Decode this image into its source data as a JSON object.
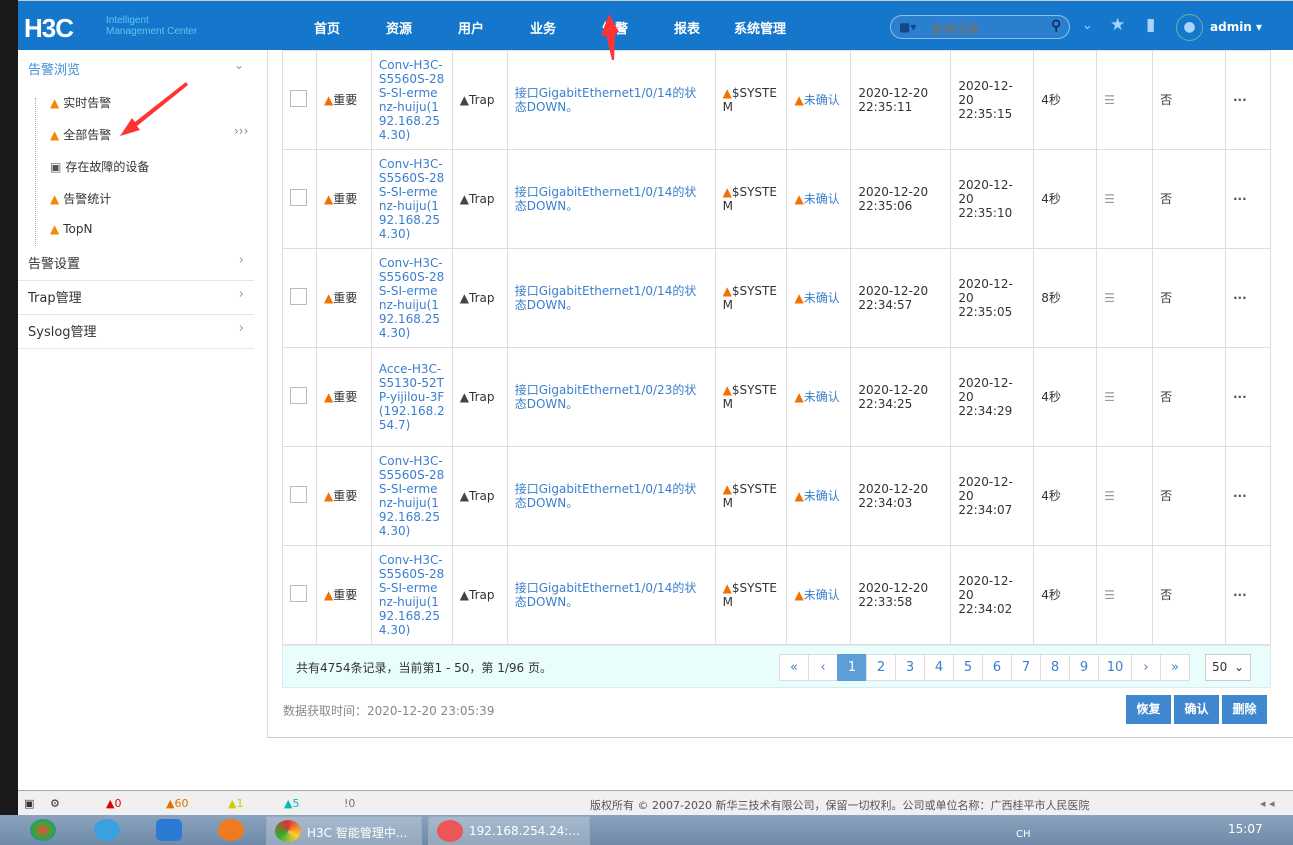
{
  "header": {
    "logo": "H3C",
    "logo_sub1": "Intelligent",
    "logo_sub2": "Management Center",
    "nav": [
      "首页",
      "资源",
      "用户",
      "业务",
      "告警",
      "报表",
      "系统管理"
    ],
    "search_placeholder": "查询设备",
    "user": "admin"
  },
  "sidebar": {
    "top": "告警浏览",
    "items": [
      "实时告警",
      "全部告警",
      "存在故障的设备",
      "告警统计",
      "TopN"
    ],
    "sections": [
      "告警设置",
      "Trap管理",
      "Syslog管理"
    ]
  },
  "rows": [
    {
      "level": "重要",
      "device": "Conv-H3C-S5560S-28S-SI-ermenz-huiju(192.168.254.30)",
      "type": "Trap",
      "desc": "接口GigabitEthernet1/0/14的状态DOWN。",
      "source": "$SYSTEM",
      "status": "未确认",
      "t1": "2020-12-20 22:35:11",
      "t2": "2020-12-20 22:35:15",
      "dur": "4秒",
      "flag": "否"
    },
    {
      "level": "重要",
      "device": "Conv-H3C-S5560S-28S-SI-ermenz-huiju(192.168.254.30)",
      "type": "Trap",
      "desc": "接口GigabitEthernet1/0/14的状态DOWN。",
      "source": "$SYSTEM",
      "status": "未确认",
      "t1": "2020-12-20 22:35:06",
      "t2": "2020-12-20 22:35:10",
      "dur": "4秒",
      "flag": "否"
    },
    {
      "level": "重要",
      "device": "Conv-H3C-S5560S-28S-SI-ermenz-huiju(192.168.254.30)",
      "type": "Trap",
      "desc": "接口GigabitEthernet1/0/14的状态DOWN。",
      "source": "$SYSTEM",
      "status": "未确认",
      "t1": "2020-12-20 22:34:57",
      "t2": "2020-12-20 22:35:05",
      "dur": "8秒",
      "flag": "否"
    },
    {
      "level": "重要",
      "device": "Acce-H3C-S5130-52TP-yijilou-3F(192.168.254.7)",
      "type": "Trap",
      "desc": "接口GigabitEthernet1/0/23的状态DOWN。",
      "source": "$SYSTEM",
      "status": "未确认",
      "t1": "2020-12-20 22:34:25",
      "t2": "2020-12-20 22:34:29",
      "dur": "4秒",
      "flag": "否"
    },
    {
      "level": "重要",
      "device": "Conv-H3C-S5560S-28S-SI-ermenz-huiju(192.168.254.30)",
      "type": "Trap",
      "desc": "接口GigabitEthernet1/0/14的状态DOWN。",
      "source": "$SYSTEM",
      "status": "未确认",
      "t1": "2020-12-20 22:34:03",
      "t2": "2020-12-20 22:34:07",
      "dur": "4秒",
      "flag": "否"
    },
    {
      "level": "重要",
      "device": "Conv-H3C-S5560S-28S-SI-ermenz-huiju(192.168.254.30)",
      "type": "Trap",
      "desc": "接口GigabitEthernet1/0/14的状态DOWN。",
      "source": "$SYSTEM",
      "status": "未确认",
      "t1": "2020-12-20 22:33:58",
      "t2": "2020-12-20 22:34:02",
      "dur": "4秒",
      "flag": "否"
    }
  ],
  "pager": {
    "info": "共有4754条记录，当前第1 - 50，第 1/96 页。",
    "pages": [
      "«",
      "‹",
      "1",
      "2",
      "3",
      "4",
      "5",
      "6",
      "7",
      "8",
      "9",
      "10",
      "›",
      "»"
    ],
    "active": "1",
    "page_size": "50"
  },
  "fetch_time": "数据获取时间：2020-12-20 23:05:39",
  "buttons": {
    "restore": "恢复",
    "confirm": "确认",
    "delete": "删除"
  },
  "status_bar": {
    "critical": "0",
    "major": "60",
    "minor": "1",
    "warning": "5",
    "info": "0",
    "copyright": "版权所有 © 2007-2020 新华三技术有限公司，保留一切权利。公司或单位名称：广西桂平市人民医院"
  },
  "taskbar": {
    "task1": "H3C 智能管理中...",
    "task2": "192.168.254.24:...",
    "lang": "CH",
    "time": "15:07"
  },
  "colors": {
    "header": "#1477cb",
    "accent": "#3a7fcf"
  }
}
